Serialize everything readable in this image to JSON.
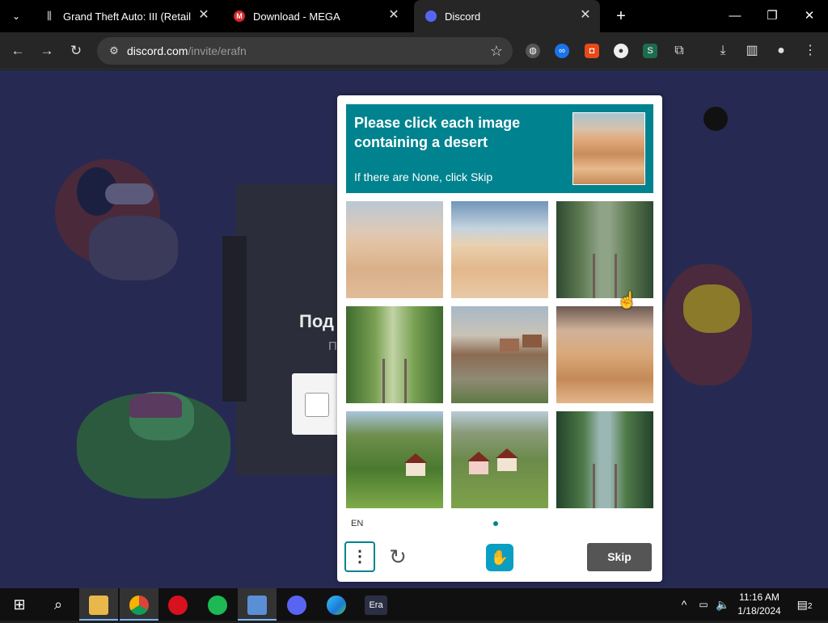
{
  "browser": {
    "tabs": [
      {
        "title": "Grand Theft Auto: III (Retail Edit",
        "icon": "columns-icon",
        "icon_color": "#dddddd"
      },
      {
        "title": "Download - MEGA",
        "icon": "mega-icon",
        "icon_color": "#d9272e"
      },
      {
        "title": "Discord",
        "icon": "discord-icon",
        "icon_color": "#5865f2"
      }
    ],
    "url_host": "discord.com",
    "url_path": "/invite/erafn"
  },
  "page": {
    "heading": "Под",
    "subheading": "П"
  },
  "captcha": {
    "prompt": "Please click each image containing a desert",
    "hint": "If there are None, click Skip",
    "language": "EN",
    "skip_label": "Skip",
    "accent_color": "#00838f",
    "images": [
      "desert-road",
      "desert-dunes",
      "forest-railway",
      "forest-railway",
      "village-road",
      "desert-dunes",
      "countryside-house",
      "village-houses",
      "forest-railway-river"
    ]
  },
  "taskbar": {
    "apps": [
      "file-explorer",
      "chrome",
      "opera",
      "spotify",
      "control-panel",
      "discord",
      "edge",
      "era"
    ],
    "era_label": "Era",
    "time": "11:16 AM",
    "date": "1/18/2024",
    "notifications": "2"
  }
}
